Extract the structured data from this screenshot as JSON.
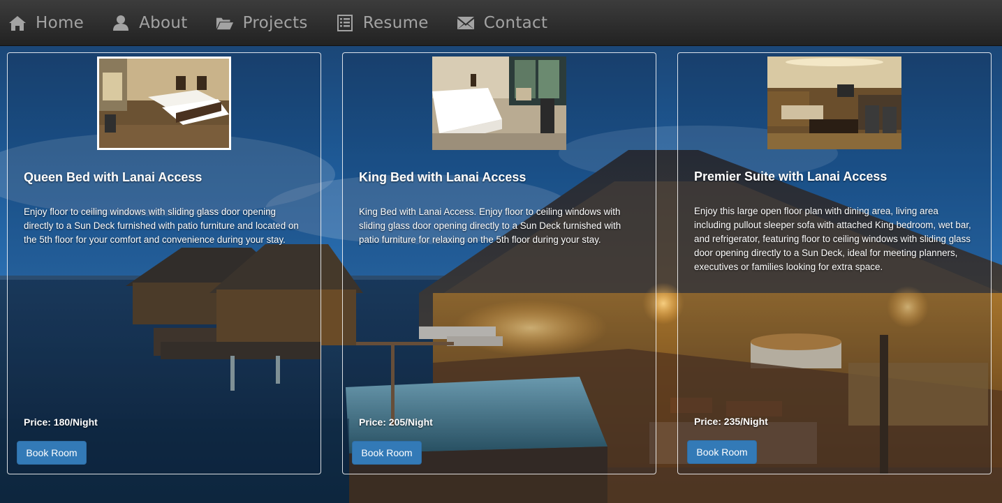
{
  "nav": {
    "items": [
      {
        "label": "Home",
        "icon": "home-icon"
      },
      {
        "label": "About",
        "icon": "user-icon"
      },
      {
        "label": "Projects",
        "icon": "folder-open-icon"
      },
      {
        "label": "Resume",
        "icon": "list-alt-icon"
      },
      {
        "label": "Contact",
        "icon": "envelope-icon"
      }
    ]
  },
  "rooms": [
    {
      "title": "Queen Bed with Lanai Access",
      "description": "Enjoy floor to ceiling windows with sliding glass door opening directly to a Sun Deck furnished with patio furniture and located on the 5th floor for your comfort and convenience during your stay.",
      "price": "Price: 180/Night",
      "button": "Book Room"
    },
    {
      "title": "King Bed with Lanai Access",
      "description": "King Bed with Lanai Access. Enjoy floor to ceiling windows with sliding glass door opening directly to a Sun Deck furnished with patio furniture for relaxing on the 5th floor during your stay.",
      "price": "Price: 205/Night",
      "button": "Book Room"
    },
    {
      "title": "Premier Suite with Lanai Access",
      "description": "Enjoy this large open floor plan with dining area, living area including pullout sleeper sofa with attached King bedroom, wet bar, and refrigerator, featuring floor to ceiling windows with sliding glass door opening directly to a Sun Deck, ideal for meeting planners, executives or families looking for extra space.",
      "price": "Price: 235/Night",
      "button": "Book Room"
    }
  ],
  "colors": {
    "navbar": "#2b2b2b",
    "nav_text": "#9d9d9d",
    "button": "#337ab7",
    "card_border": "#ffffff"
  }
}
